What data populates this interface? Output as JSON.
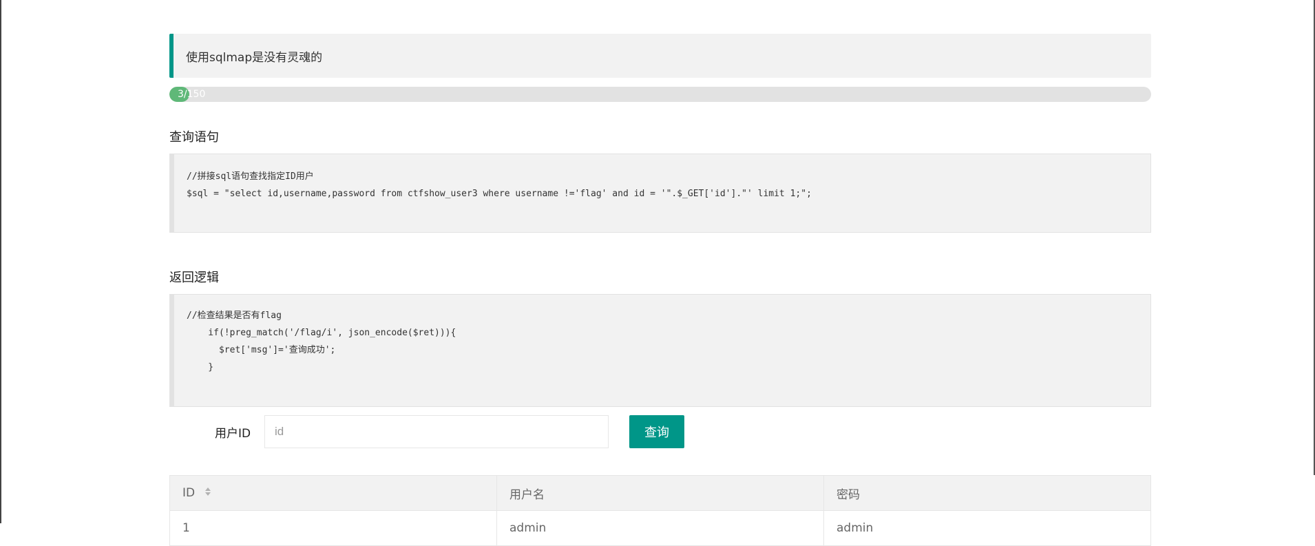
{
  "notice": {
    "text": "使用sqlmap是没有灵魂的"
  },
  "progress": {
    "label": "3/150",
    "current": 3,
    "total": 150,
    "fraction": 0.02,
    "fill_color": "#5fb878"
  },
  "query_section": {
    "title": "查询语句",
    "code_lines": [
      "//拼接sql语句查找指定ID用户",
      "$sql = \"select id,username,password from ctfshow_user3 where username !='flag' and id = '\".$_GET['id'].\"' limit 1;\";"
    ]
  },
  "return_section": {
    "title": "返回逻辑",
    "code_lines": [
      "//检查结果是否有flag",
      "    if(!preg_match('/flag/i', json_encode($ret))){",
      "      $ret['msg']='查询成功';",
      "    }"
    ]
  },
  "search": {
    "label": "用户ID",
    "placeholder": "id",
    "value": "",
    "button_label": "查询"
  },
  "table": {
    "columns": [
      "ID",
      "用户名",
      "密码"
    ],
    "rows": [
      [
        "1",
        "admin",
        "admin"
      ]
    ]
  },
  "colors": {
    "accent": "#009688",
    "progress": "#5fb878"
  },
  "icons": {
    "sort": "sort-icon"
  }
}
